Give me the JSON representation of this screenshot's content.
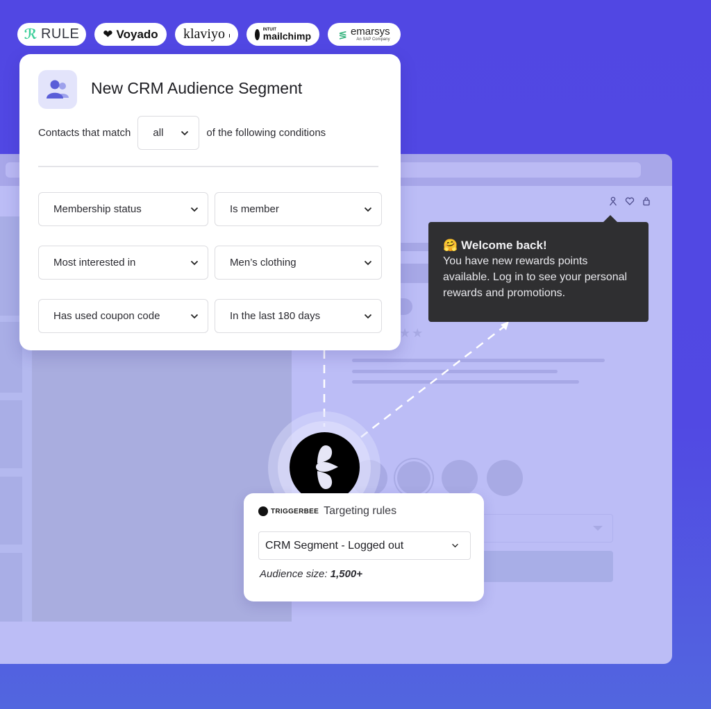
{
  "integrations": [
    {
      "name": "RULE"
    },
    {
      "name": "Voyado"
    },
    {
      "name": "klaviyo"
    },
    {
      "name": "mailchimp",
      "prefix": "INTUIT"
    },
    {
      "name": "emarsys",
      "subtitle": "An SAP Company"
    }
  ],
  "segment": {
    "icon": "users-icon",
    "title": "New CRM Audience Segment",
    "match_prefix": "Contacts that match",
    "match_value": "all",
    "match_suffix": "of the following conditions",
    "conditions": [
      {
        "field": "Membership status",
        "value": "Is member"
      },
      {
        "field": "Most interested in",
        "value": "Men’s clothing"
      },
      {
        "field": "Has used coupon code",
        "value": "In the last 180 days"
      }
    ]
  },
  "site": {
    "nav_icons": [
      "user-icon",
      "heart-icon",
      "shopping-bag-icon"
    ],
    "rating_stars": 2
  },
  "tooltip": {
    "emoji": "🤗",
    "title": "Welcome back!",
    "body": "You have new rewards points available. Log in to see your personal rewards and promotions."
  },
  "targeting": {
    "brand": "TRIGGERBEE",
    "label": "Targeting rules",
    "selected_rule": "CRM Segment - Logged out",
    "audience_label": "Audience size:",
    "audience_value": "1,500+"
  },
  "colors": {
    "background": "#5147e3",
    "browser": "#bcbdf6",
    "tooltip": "#2f2f31",
    "segment_icon_bg": "#e3e4fb",
    "segment_icon": "#5a5ed8"
  }
}
